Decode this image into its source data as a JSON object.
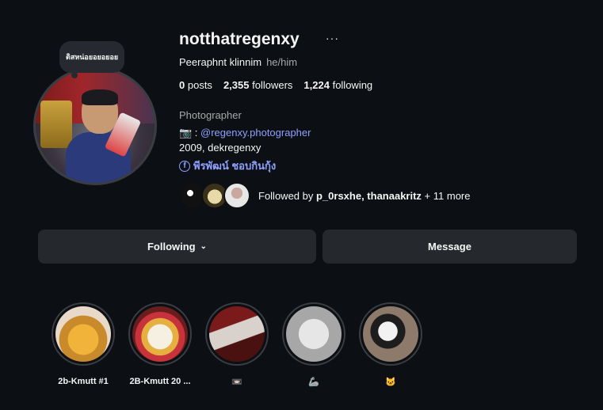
{
  "profile": {
    "note": "ติสหน่อยอยอยอย",
    "username": "notthatregenxy",
    "more_icon": "more-horizontal-icon",
    "full_name": "Peeraphnt klinnim",
    "pronouns": "he/him",
    "stats": {
      "posts_count": "0",
      "posts_label": "posts",
      "followers_count": "2,355",
      "followers_label": "followers",
      "following_count": "1,224",
      "following_label": "following"
    },
    "category": "Photographer",
    "bio_prefix": "📷 : ",
    "bio_link": "@regenxy.photographer",
    "bio_line2": "2009, dekregenxy",
    "facebook_name": "พีรพัฒน์ ชอบกินกุ้ง",
    "followed_by_prefix": "Followed by ",
    "followed_by_users": "p_0rsxhe, thanaakritz",
    "followed_by_suffix": " + 11 more"
  },
  "actions": {
    "following_label": "Following",
    "message_label": "Message"
  },
  "highlights": [
    {
      "label": "2b-Kmutt #1"
    },
    {
      "label": "2B-Kmutt 20 ..."
    },
    {
      "label": "📼"
    },
    {
      "label": "🦾"
    },
    {
      "label": "🐱"
    }
  ],
  "colors": {
    "background": "#0c1014",
    "button": "#25292e",
    "link": "#8ea0ff",
    "secondary_text": "#a8a8a8"
  }
}
